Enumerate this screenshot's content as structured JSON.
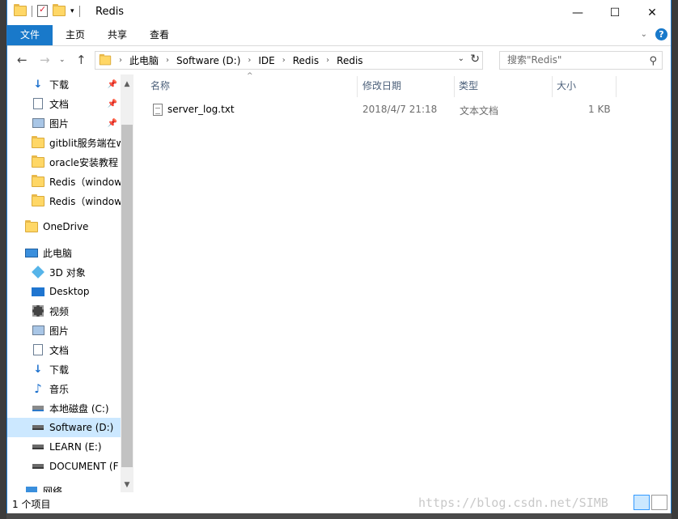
{
  "window": {
    "title": "Redis",
    "controls": {
      "minimize": "—",
      "maximize": "☐",
      "close": "✕"
    }
  },
  "ribbon": {
    "tabs": [
      "文件",
      "主页",
      "共享",
      "查看"
    ],
    "expand_icon": "chevron-down-icon",
    "help": "?"
  },
  "address": {
    "crumbs": [
      "此电脑",
      "Software (D:)",
      "IDE",
      "Redis",
      "Redis"
    ],
    "search_placeholder": "搜索\"Redis\""
  },
  "nav": {
    "quick_access": [
      {
        "label": "下载",
        "icon": "download-icon",
        "pinned": true
      },
      {
        "label": "文档",
        "icon": "document-icon",
        "pinned": true
      },
      {
        "label": "图片",
        "icon": "pictures-icon",
        "pinned": true
      },
      {
        "label": "gitblit服务端在w",
        "icon": "folder-icon",
        "pinned": false
      },
      {
        "label": "oracle安装教程",
        "icon": "folder-icon",
        "pinned": false
      },
      {
        "label": "Redis（window",
        "icon": "folder-icon",
        "pinned": false
      },
      {
        "label": "Redis（window",
        "icon": "folder-icon",
        "pinned": false
      }
    ],
    "onedrive": "OneDrive",
    "this_pc": "此电脑",
    "pc_items": [
      {
        "label": "3D 对象",
        "icon": "3d-objects-icon"
      },
      {
        "label": "Desktop",
        "icon": "desktop-icon"
      },
      {
        "label": "视频",
        "icon": "videos-icon"
      },
      {
        "label": "图片",
        "icon": "pictures-icon"
      },
      {
        "label": "文档",
        "icon": "document-icon"
      },
      {
        "label": "下载",
        "icon": "download-icon"
      },
      {
        "label": "音乐",
        "icon": "music-icon"
      },
      {
        "label": "本地磁盘 (C:)",
        "icon": "system-drive-icon"
      },
      {
        "label": "Software (D:)",
        "icon": "drive-icon",
        "selected": true
      },
      {
        "label": "LEARN (E:)",
        "icon": "drive-icon"
      },
      {
        "label": "DOCUMENT (F",
        "icon": "drive-icon"
      }
    ],
    "network": "网络"
  },
  "columns": {
    "name": "名称",
    "modified": "修改日期",
    "type": "类型",
    "size": "大小"
  },
  "files": [
    {
      "name": "server_log.txt",
      "modified": "2018/4/7 21:18",
      "type": "文本文档",
      "size": "1 KB"
    }
  ],
  "status": {
    "count": "1 个项目",
    "watermark": "https://blog.csdn.net/SIMB"
  }
}
